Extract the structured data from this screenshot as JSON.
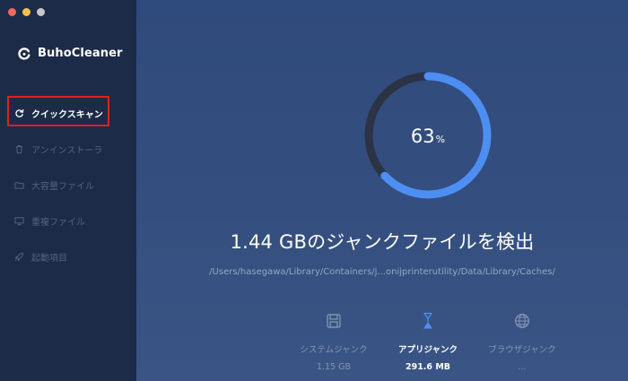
{
  "brand": {
    "name": "BuhoCleaner"
  },
  "nav": {
    "items": [
      {
        "label": "クイックスキャン",
        "icon": "refresh-icon",
        "active": true
      },
      {
        "label": "アンインストーラ",
        "icon": "trash-icon",
        "active": false
      },
      {
        "label": "大容量ファイル",
        "icon": "folder-icon",
        "active": false
      },
      {
        "label": "重複ファイル",
        "icon": "monitor-icon",
        "active": false
      },
      {
        "label": "起動項目",
        "icon": "rocket-icon",
        "active": false
      }
    ]
  },
  "scan": {
    "progress_value": "63",
    "progress_unit": "%",
    "progress_fraction": 0.63,
    "headline": "1.44 GBのジャンクファイルを検出",
    "current_path": "/Users/hasegawa/Library/Containers/j...onijprinterutility/Data/Library/Caches/"
  },
  "categories": [
    {
      "name": "システムジャンク",
      "size": "1.15 GB",
      "icon": "disk-icon",
      "active": false
    },
    {
      "name": "アプリジャンク",
      "size": "291.6 MB",
      "icon": "app-icon",
      "active": true
    },
    {
      "name": "ブラウザジャンク",
      "size": "...",
      "icon": "globe-icon",
      "active": false
    }
  ],
  "colors": {
    "sidebar_bg": "#1c2b48",
    "main_bg": "#2f4a7a",
    "accent_blue": "#4d8ef2",
    "track": "#2b3344",
    "highlight_red": "#e02020"
  }
}
